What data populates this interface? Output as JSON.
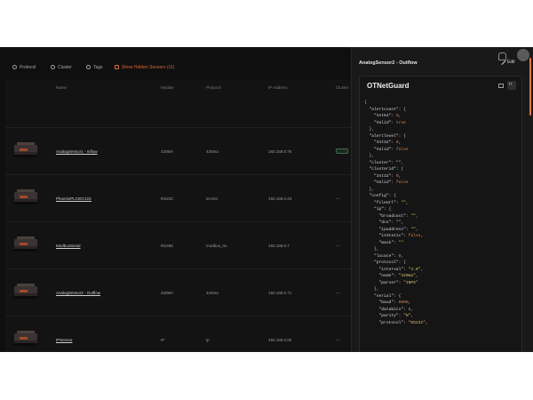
{
  "filters": [
    {
      "label": "Protocol",
      "icon": "plus-circle-icon"
    },
    {
      "label": "Cluster",
      "icon": "plus-circle-icon"
    },
    {
      "label": "Tags",
      "icon": "plus-circle-icon"
    },
    {
      "label": "Show Hidden Sensors (11)",
      "icon": "eye-icon",
      "color": "#d96a3b"
    }
  ],
  "table": {
    "headers": [
      "Name",
      "Module",
      "Protocol",
      "IP Address",
      "Cluster"
    ],
    "rows": [
      {
        "name": "AnalogSensor1 - Inflow",
        "module": "420MA",
        "protocol": "420ma",
        "ip": "192.168.0.76",
        "status": "badge"
      },
      {
        "name": "PhoenixPLCIEC101",
        "module": "RS232",
        "protocol": "iec101",
        "ip": "192.168.0.43",
        "status": "—"
      },
      {
        "name": "ModbusSerial",
        "module": "RS485",
        "protocol": "modbus_rtu",
        "ip": "192.168.0.7",
        "status": "—"
      },
      {
        "name": "AnalogSensor2 - Outflow",
        "module": "420MA",
        "protocol": "420ma",
        "ip": "192.168.0.71",
        "status": "—"
      },
      {
        "name": "IPSensor",
        "module": "IP",
        "protocol": "ip",
        "ip": "192.168.0.65",
        "status": "—"
      }
    ]
  },
  "panel": {
    "title": "AnalogSensor2 - Outflow",
    "edit_label": "Edit",
    "card_title": "OTNetGuard",
    "code_lines": [
      "{",
      "  \"alertcount\": {",
      "    \"Int64\": 0,",
      "    \"Valid\": true",
      "  },",
      "  \"alertlevel\": {",
      "    \"Int32\": 0,",
      "    \"Valid\": false",
      "  },",
      "  \"cluster\": \"\",",
      "  \"clusterid\": {",
      "    \"Int32\": 0,",
      "    \"Valid\": false",
      "  },",
      "  \"config\": {",
      "    \"fileUrl\": \"\",",
      "    \"ip\": {",
      "      \"broadcast\": \"\",",
      "      \"dns\": \"\",",
      "      \"ipaddress\": \"\",",
      "      \"isStatic\": false,",
      "      \"mask\": \"\"",
      "    },",
      "    \"locate\": 0,",
      "    \"protocol\": {",
      "      \"interval\": \"4.0\",",
      "      \"name\": \"420ma\",",
      "      \"parser\": \"INPS\"",
      "    },",
      "    \"serial\": {",
      "      \"baud\": 9600,",
      "      \"databits\": 8,",
      "      \"parity\": \"N\",",
      "      \"protocol\": \"RS232\","
    ]
  },
  "colors": {
    "accent": "#e07a4a",
    "background": "#0f0f10",
    "panel": "#19191a"
  }
}
